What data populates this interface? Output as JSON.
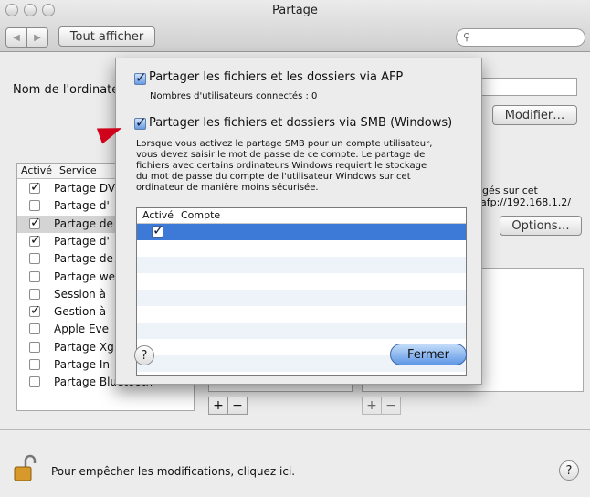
{
  "window": {
    "title": "Partage",
    "show_all": "Tout afficher",
    "nav_back": "◀",
    "nav_forward": "▶",
    "search_icon": "search-icon"
  },
  "main": {
    "computer_name_label": "Nom de l'ordinate",
    "modify_button": "Modifier…",
    "options_button": "Options…",
    "right_text_1": "gés sur cet",
    "right_text_2": "afp://192.168.1.2/",
    "service_table": {
      "headers": [
        "Activé",
        "Service"
      ],
      "rows": [
        {
          "checked": true,
          "name": "Partage DV",
          "selected": false
        },
        {
          "checked": false,
          "name": "Partage d'",
          "selected": false
        },
        {
          "checked": true,
          "name": "Partage de",
          "selected": true
        },
        {
          "checked": true,
          "name": "Partage d'",
          "selected": false
        },
        {
          "checked": false,
          "name": "Partage de",
          "selected": false
        },
        {
          "checked": false,
          "name": "Partage we",
          "selected": false
        },
        {
          "checked": false,
          "name": "Session à",
          "selected": false
        },
        {
          "checked": true,
          "name": "Gestion à",
          "selected": false
        },
        {
          "checked": false,
          "name": "Apple Eve",
          "selected": false
        },
        {
          "checked": false,
          "name": "Partage Xg",
          "selected": false
        },
        {
          "checked": false,
          "name": "Partage In",
          "selected": false
        },
        {
          "checked": false,
          "name": "Partage Bluetooth",
          "selected": false
        }
      ]
    },
    "plus": "+",
    "minus": "−",
    "lock_text": "Pour empêcher les modifications, cliquez ici.",
    "help": "?"
  },
  "dialog": {
    "afp_label": "Partager les fichiers et les dossiers via AFP",
    "afp_users": "Nombres d'utilisateurs connectés : 0",
    "smb_label": "Partager les fichiers et dossiers via SMB (Windows)",
    "smb_paragraph": [
      "Lorsque vous activez le partage SMB pour un compte utilisateur,",
      "vous devez saisir le mot de passe de ce compte. Le partage de",
      "fichiers avec certains ordinateurs Windows requiert le stockage",
      "du mot de passe du compte de l'utilisateur Windows sur cet",
      "ordinateur de manière moins sécurisée."
    ],
    "account_headers": [
      "Activé",
      "Compte"
    ],
    "help": "?",
    "close_button": "Fermer"
  },
  "colors": {
    "accent": "#3d79d6",
    "arrow": "#d0021b"
  }
}
